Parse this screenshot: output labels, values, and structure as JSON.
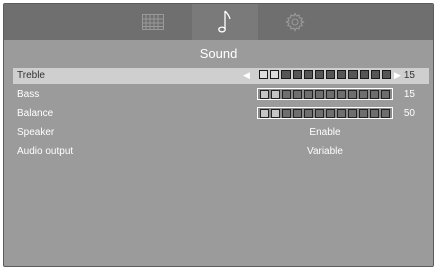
{
  "tabs": {
    "picture_icon": "picture-grid-icon",
    "sound_icon": "music-note-icon",
    "setup_icon": "gear-icon",
    "active": "sound"
  },
  "title": "Sound",
  "rows": [
    {
      "label": "Treble",
      "value": "15",
      "segments": 12,
      "filled": 2,
      "selected": true
    },
    {
      "label": "Bass",
      "value": "15",
      "segments": 12,
      "filled": 2,
      "selected": false
    },
    {
      "label": "Balance",
      "value": "50",
      "segments": 12,
      "filled": 2,
      "selected": false
    },
    {
      "label": "Speaker",
      "value": "Enable",
      "selected": false
    },
    {
      "label": "Audio output",
      "value": "Variable",
      "selected": false
    }
  ],
  "colors": {
    "menu_background": "#9b9b9b",
    "topbar": "#6f6f6f",
    "selected_row": "#cfcfcf",
    "text": "#ffffff"
  }
}
